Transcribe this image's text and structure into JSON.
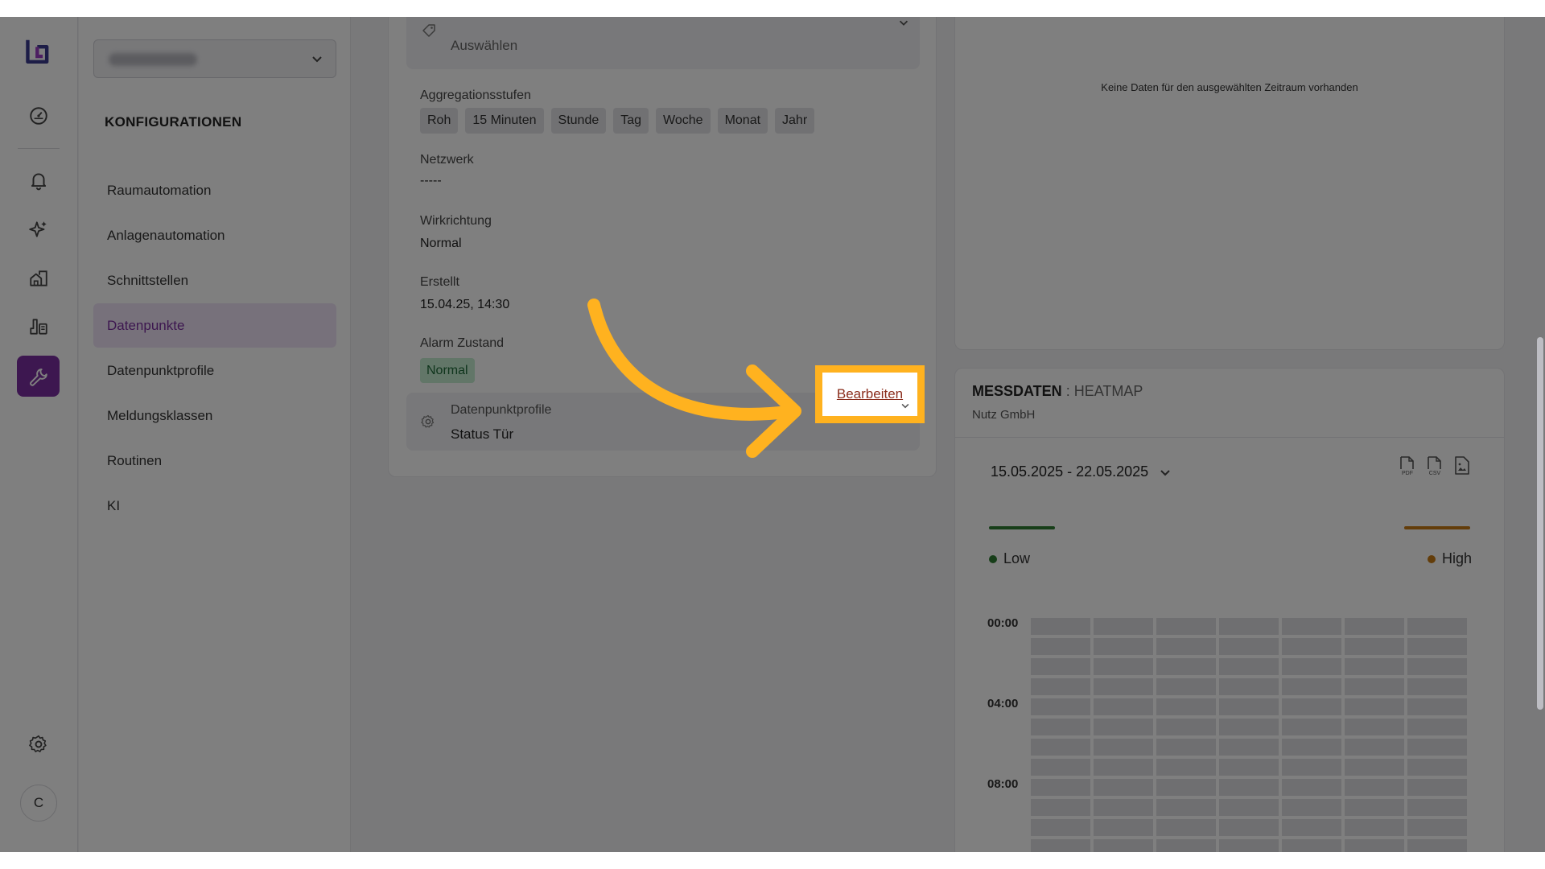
{
  "sidebar": {
    "title": "KONFIGURATIONEN",
    "items": [
      {
        "label": "Raumautomation"
      },
      {
        "label": "Anlagenautomation"
      },
      {
        "label": "Schnittstellen"
      },
      {
        "label": "Datenpunkte"
      },
      {
        "label": "Datenpunktprofile"
      },
      {
        "label": "Meldungsklassen"
      },
      {
        "label": "Routinen"
      },
      {
        "label": "KI"
      }
    ],
    "active_item": "Datenpunkte"
  },
  "rail": {
    "icons": [
      "logo-icon",
      "dashboard-icon",
      "bell-icon",
      "sparkles-icon",
      "buildings-icon",
      "devices-icon",
      "wrench-icon",
      "gear-icon"
    ],
    "active": "wrench-icon",
    "avatar_initial": "C"
  },
  "detail": {
    "tag_placeholder": "Auswählen",
    "aggregation_label": "Aggregationsstufen",
    "aggregation_levels": [
      "Roh",
      "15 Minuten",
      "Stunde",
      "Tag",
      "Woche",
      "Monat",
      "Jahr"
    ],
    "network_label": "Netzwerk",
    "network_value": "-----",
    "direction_label": "Wirkrichtung",
    "direction_value": "Normal",
    "created_label": "Erstellt",
    "created_value": "15.04.25, 14:30",
    "alarm_label": "Alarm Zustand",
    "alarm_value": "Normal",
    "profile_label": "Datenpunktprofile",
    "profile_value": "Status Tür",
    "edit_label": "Bearbeiten"
  },
  "chart_panel": {
    "empty_message": "Keine Daten für den ausgewählten Zeitraum vorhanden"
  },
  "heatmap": {
    "title": "MESSDATEN",
    "separator": " : ",
    "subtitle": "HEATMAP",
    "company": "Nutz GmbH",
    "date_range": "15.05.2025 - 22.05.2025",
    "export_icons": [
      "pdf-icon",
      "csv-icon",
      "image-icon"
    ],
    "legend_low": "Low",
    "legend_high": "High",
    "hour_labels": [
      "00:00",
      "04:00",
      "08:00"
    ]
  },
  "colors": {
    "accent": "#7b2fa0",
    "highlight": "#ffb21f",
    "low": "#2e7d32",
    "high": "#c77a15",
    "alarm_normal_bg": "#c4ecd0"
  }
}
